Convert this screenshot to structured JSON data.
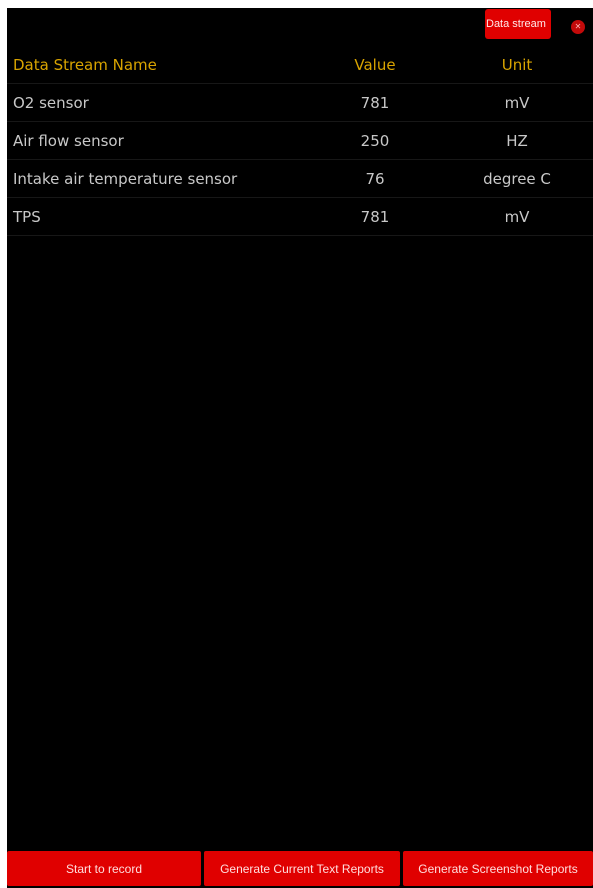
{
  "top_bar": {
    "mode_button_label": "Data stream",
    "close_icon": "close-icon",
    "accent_color": "#e00000"
  },
  "table": {
    "headers": {
      "name": "Data Stream Name",
      "value": "Value",
      "unit": "Unit"
    },
    "header_color": "#d9a400",
    "rows": [
      {
        "name": "O2 sensor",
        "value": "781",
        "unit": "mV"
      },
      {
        "name": "Air flow sensor",
        "value": "250",
        "unit": "HZ"
      },
      {
        "name": "Intake air temperature sensor",
        "value": "76",
        "unit": "degree C"
      },
      {
        "name": "TPS",
        "value": "781",
        "unit": "mV"
      }
    ]
  },
  "toolbar": {
    "start_record_label": "Start to record",
    "text_report_label": "Generate Current Text Reports",
    "screenshot_report_label": "Generate Screenshot Reports"
  }
}
